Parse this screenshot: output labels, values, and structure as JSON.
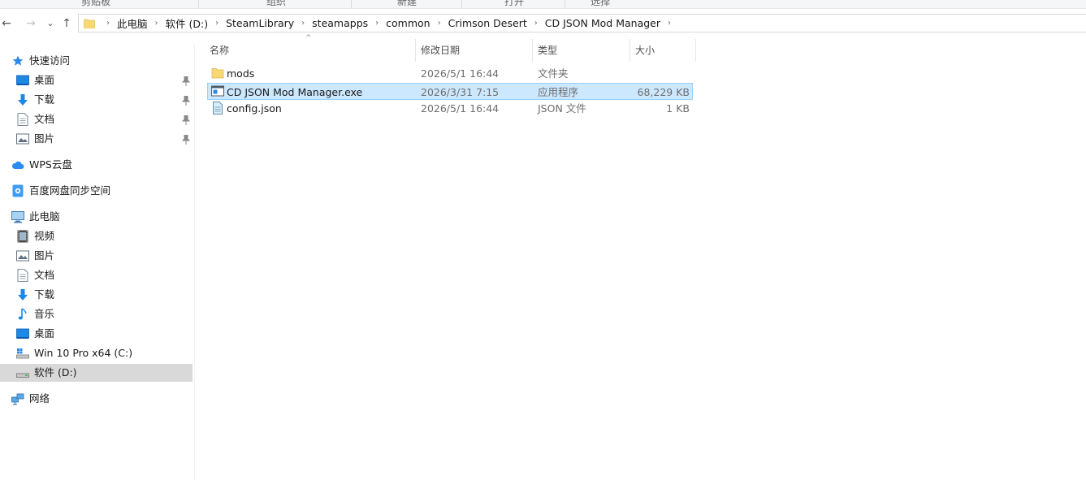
{
  "ribbon": {
    "groups": [
      "剪贴板",
      "组织",
      "新建",
      "打开",
      "选择"
    ]
  },
  "nav": {
    "back": "←",
    "forward": "→",
    "recent": "⌄",
    "up": "↑"
  },
  "address": {
    "crumbs": [
      "此电脑",
      "软件 (D:)",
      "SteamLibrary",
      "steamapps",
      "common",
      "Crimson Desert",
      "CD JSON Mod Manager"
    ]
  },
  "sidebar": {
    "quick_access": "快速访问",
    "quick_items": [
      "桌面",
      "下载",
      "文档",
      "图片"
    ],
    "wps": "WPS云盘",
    "baidu": "百度网盘同步空间",
    "this_pc": "此电脑",
    "pc_items": [
      "视频",
      "图片",
      "文档",
      "下载",
      "音乐",
      "桌面",
      "Win 10 Pro x64 (C:)",
      "软件 (D:)"
    ],
    "network": "网络"
  },
  "columns": {
    "name": "名称",
    "date": "修改日期",
    "type": "类型",
    "size": "大小"
  },
  "files": [
    {
      "name": "mods",
      "date": "2026/5/1 16:44",
      "type": "文件夹",
      "size": ""
    },
    {
      "name": "CD JSON Mod Manager.exe",
      "date": "2026/3/31 7:15",
      "type": "应用程序",
      "size": "68,229 KB"
    },
    {
      "name": "config.json",
      "date": "2026/5/1 16:44",
      "type": "JSON 文件",
      "size": "1 KB"
    }
  ],
  "colors": {
    "selection_bg": "#cce8ff",
    "selection_border": "#99d1ff",
    "sidebar_selected": "#d9d9d9",
    "folder": "#f8d775"
  }
}
